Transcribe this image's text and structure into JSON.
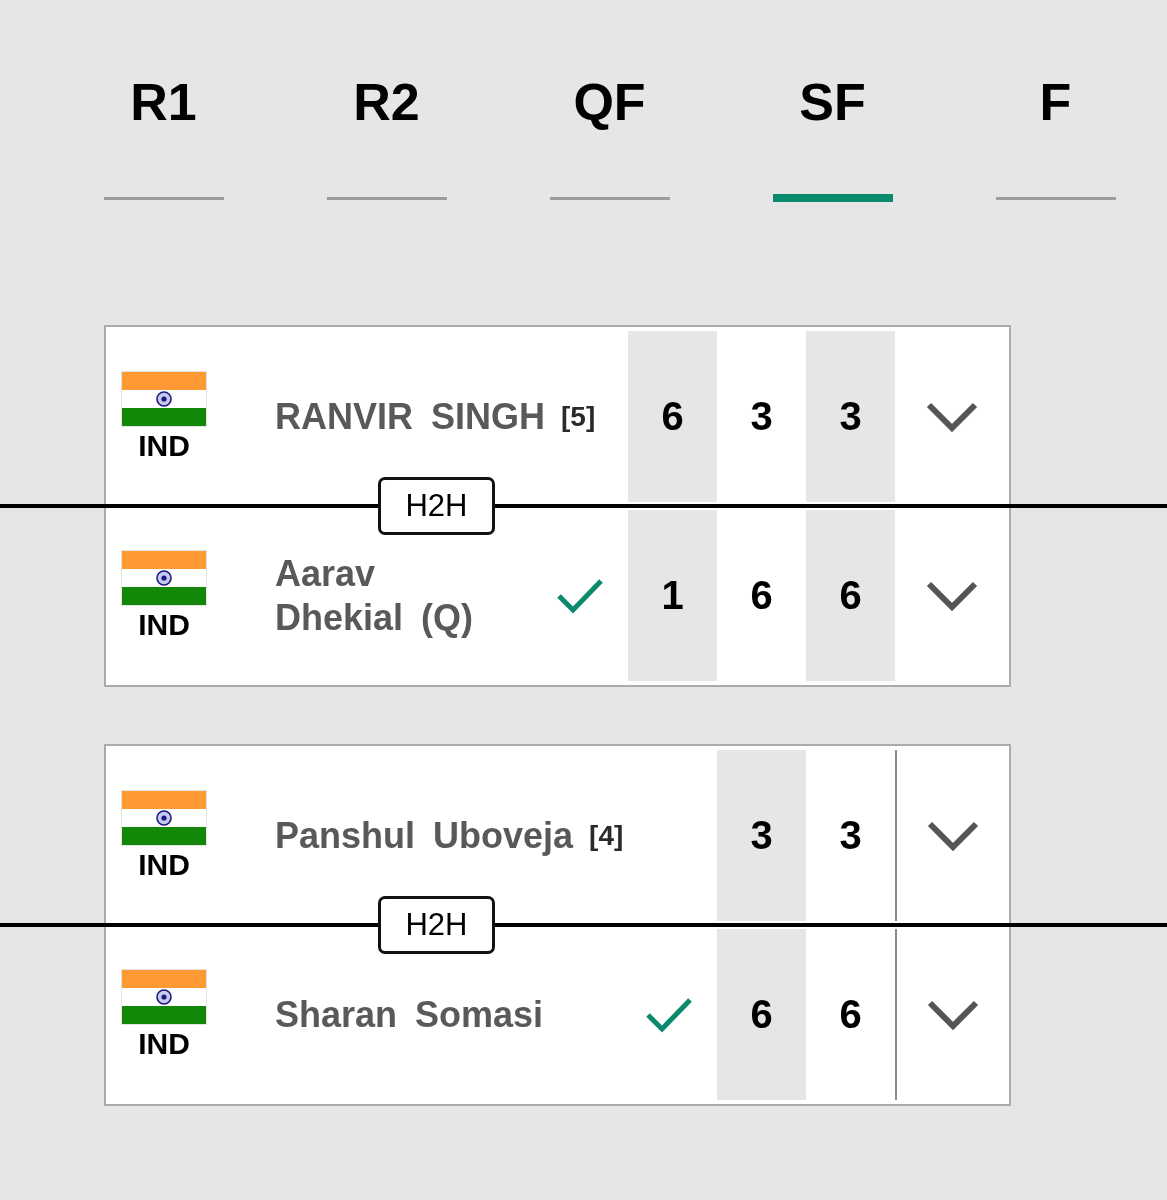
{
  "tabs": [
    {
      "label": "R1",
      "selected": false
    },
    {
      "label": "R2",
      "selected": false
    },
    {
      "label": "QF",
      "selected": false
    },
    {
      "label": "SF",
      "selected": true
    },
    {
      "label": "F",
      "selected": false
    }
  ],
  "matches": [
    {
      "h2h_label": "H2H",
      "players": [
        {
          "country": "IND",
          "name": "RANVIR SINGH",
          "seed": "[5]",
          "winner": false,
          "scores": [
            "6",
            "3",
            "3"
          ],
          "expanded": false
        },
        {
          "country": "IND",
          "name": "Aarav Dhekial (Q)",
          "winner": true,
          "scores": [
            "1",
            "6",
            "6"
          ],
          "expanded": false
        }
      ]
    },
    {
      "h2h_label": "H2H",
      "players": [
        {
          "country": "IND",
          "name": "Panshul Uboveja",
          "seed": "[4]",
          "winner": false,
          "scores": [
            "3",
            "3"
          ],
          "expanded": false
        },
        {
          "country": "IND",
          "name": "Sharan Somasi",
          "winner": true,
          "scores": [
            "6",
            "6"
          ],
          "expanded": false
        }
      ]
    }
  ]
}
